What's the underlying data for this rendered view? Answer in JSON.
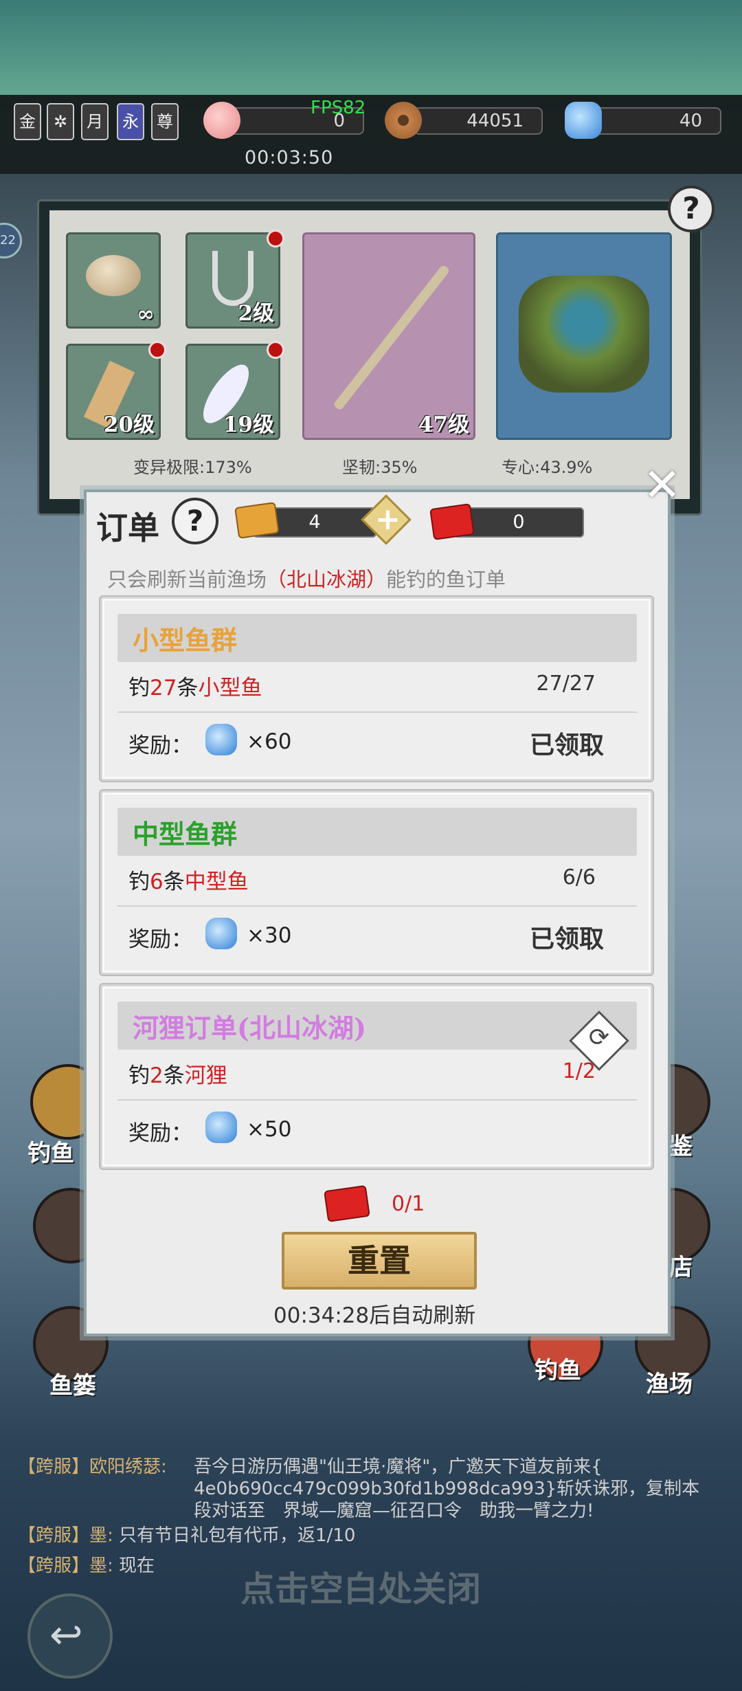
{
  "top_bar": {
    "runes": [
      "金",
      "",
      "月",
      "永",
      "尊"
    ],
    "fps": "FPS82",
    "peach_value": "0",
    "coin_value": "44051",
    "gem_value": "40",
    "timer": "00:03:50",
    "left_badge": "22"
  },
  "equipment": {
    "slots": [
      {
        "name": "bait",
        "level": "∞"
      },
      {
        "name": "hook",
        "level": "2级"
      },
      {
        "name": "float",
        "level": "20级"
      },
      {
        "name": "feather",
        "level": "19级"
      },
      {
        "name": "rod",
        "level": "47级"
      }
    ],
    "stats": [
      "变异极限:173%",
      "坚韧:35%",
      "专心:43.9%"
    ]
  },
  "dialog": {
    "title": "订单",
    "refresh_count": "4",
    "ticket_count": "0",
    "notice_prefix": "只会刷新当前渔场",
    "notice_place": "（北山冰湖）",
    "notice_suffix": "能钓的鱼订单",
    "orders": [
      {
        "title": "小型鱼群",
        "title_color": "#e8a23a",
        "task_a": "钓",
        "task_num": "27",
        "task_b": "条",
        "task_target": "小型鱼",
        "progress": "27/27",
        "reward_label": "奖励：",
        "reward_qty": "×60",
        "status": "已领取"
      },
      {
        "title": "中型鱼群",
        "title_color": "#2aa12a",
        "task_a": "钓",
        "task_num": "6",
        "task_b": "条",
        "task_target": "中型鱼",
        "progress": "6/6",
        "reward_label": "奖励：",
        "reward_qty": "×30",
        "status": "已领取"
      },
      {
        "title": "河狸订单(北山冰湖)",
        "title_color": "#d27ce0",
        "task_a": "钓",
        "task_num": "2",
        "task_b": "条",
        "task_target": "河狸",
        "progress": "1/2",
        "reward_label": "奖励：",
        "reward_qty": "×50",
        "status": ""
      }
    ],
    "ticket_progress": "0/1",
    "reset_label": "重置",
    "auto_refresh": "00:34:28后自动刷新"
  },
  "chat": [
    {
      "tag": "【跨服】",
      "name": "欧阳绣瑟:",
      "msg": "吾今日游历偶遇\"仙王境·魔将\"，广邀天下道友前来{"
    },
    {
      "tag": "",
      "name": "",
      "msg": "4e0b690cc479c099b30fd1b998dca993}斩妖诛邪，复制本"
    },
    {
      "tag": "",
      "name": "",
      "msg": "段对话至　界域—魔窟—征召口令　助我一臂之力!"
    },
    {
      "tag": "【跨服】",
      "name": "墨:",
      "msg": "只有节日礼包有代币，返1/10"
    },
    {
      "tag": "【跨服】",
      "name": "墨:",
      "msg": "现在"
    }
  ],
  "close_hint": "点击空白处关闭",
  "side_buttons": {
    "fish": "钓鱼",
    "basket": "鱼篓",
    "guide": "鉴",
    "shop": "店",
    "lure": "钓鱼",
    "fishery": "渔场"
  }
}
